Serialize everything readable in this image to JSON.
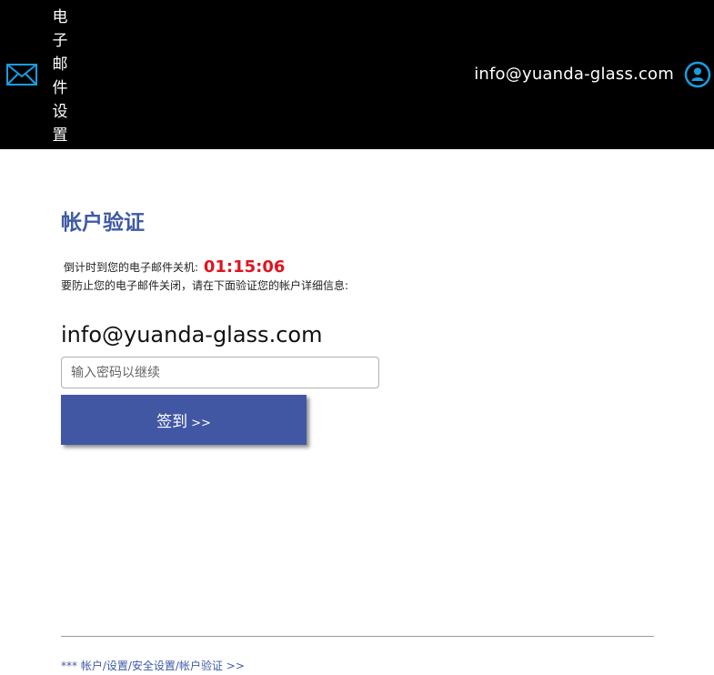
{
  "header": {
    "app_title": "电子邮件设置",
    "email": "info@yuanda-glass.com",
    "icons": [
      "mail-icon",
      "user-icon"
    ],
    "background_color": "#000000",
    "icon_color": "#1a9ce0"
  },
  "main": {
    "title": "帐户验证",
    "countdown_label": "倒计时到您的电子邮件关机:",
    "countdown_value": "01:15:06",
    "instruction": "要防止您的电子邮件关闭，请在下面验证您的帐户详细信息:",
    "email": "info@yuanda-glass.com",
    "password_placeholder": "输入密码以继续",
    "signin_label": "签到",
    "signin_arrows": ">>",
    "accent_color": "#4257a4",
    "countdown_color": "#e0141e"
  },
  "footer": {
    "link_text": "*** 帐户/设置/安全设置/帐户验证 >>"
  }
}
